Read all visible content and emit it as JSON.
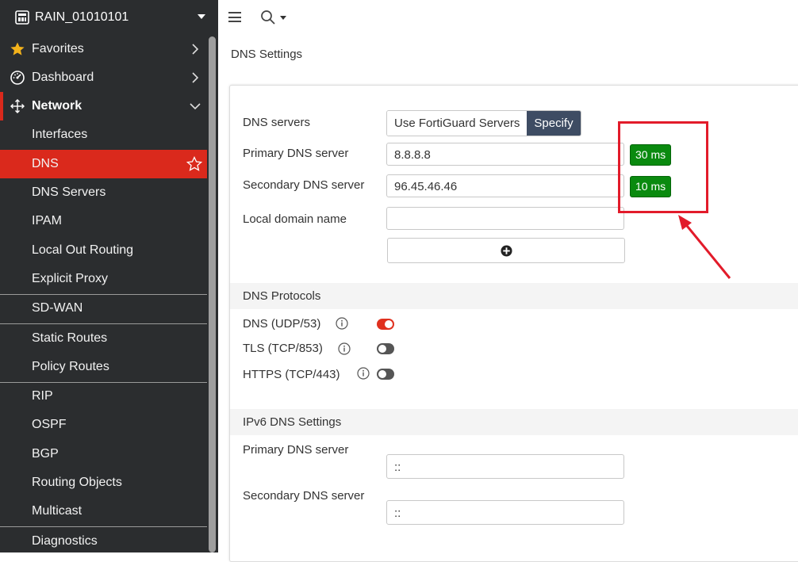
{
  "device": {
    "name": "RAIN_01010101"
  },
  "sidebar": {
    "items": [
      {
        "label": "Favorites",
        "icon": "star-icon"
      },
      {
        "label": "Dashboard",
        "icon": "dashboard-icon"
      },
      {
        "label": "Network",
        "icon": "network-icon"
      },
      {
        "label": "Interfaces"
      },
      {
        "label": "DNS"
      },
      {
        "label": "DNS Servers"
      },
      {
        "label": "IPAM"
      },
      {
        "label": "Local Out Routing"
      },
      {
        "label": "Explicit Proxy"
      },
      {
        "label": "SD-WAN"
      },
      {
        "label": "Static Routes"
      },
      {
        "label": "Policy Routes"
      },
      {
        "label": "RIP"
      },
      {
        "label": "OSPF"
      },
      {
        "label": "BGP"
      },
      {
        "label": "Routing Objects"
      },
      {
        "label": "Multicast"
      },
      {
        "label": "Diagnostics"
      }
    ]
  },
  "page": {
    "title": "DNS Settings"
  },
  "dns": {
    "servers_label": "DNS servers",
    "options": [
      "Use FortiGuard Servers",
      "Specify"
    ],
    "selected_option": "Specify",
    "primary_label": "Primary DNS server",
    "primary_value": "8.8.8.8",
    "primary_latency": "30 ms",
    "secondary_label": "Secondary DNS server",
    "secondary_value": "96.45.46.46",
    "secondary_latency": "10 ms",
    "local_domain_label": "Local domain name",
    "local_domain_value": ""
  },
  "protocols": {
    "title": "DNS Protocols",
    "items": [
      {
        "label": "DNS (UDP/53)",
        "enabled": true
      },
      {
        "label": "TLS (TCP/853)",
        "enabled": false
      },
      {
        "label": "HTTPS (TCP/443)",
        "enabled": false
      }
    ]
  },
  "ipv6": {
    "title": "IPv6 DNS Settings",
    "primary_label": "Primary DNS server",
    "primary_value": "::",
    "secondary_label": "Secondary DNS server",
    "secondary_value": "::"
  },
  "colors": {
    "sidebar_bg": "#2b2d2f",
    "active_item": "#da291c",
    "selected_segment": "#3e4c63",
    "latency_badge": "#0a8a0f",
    "annotation": "#e21b2a"
  }
}
